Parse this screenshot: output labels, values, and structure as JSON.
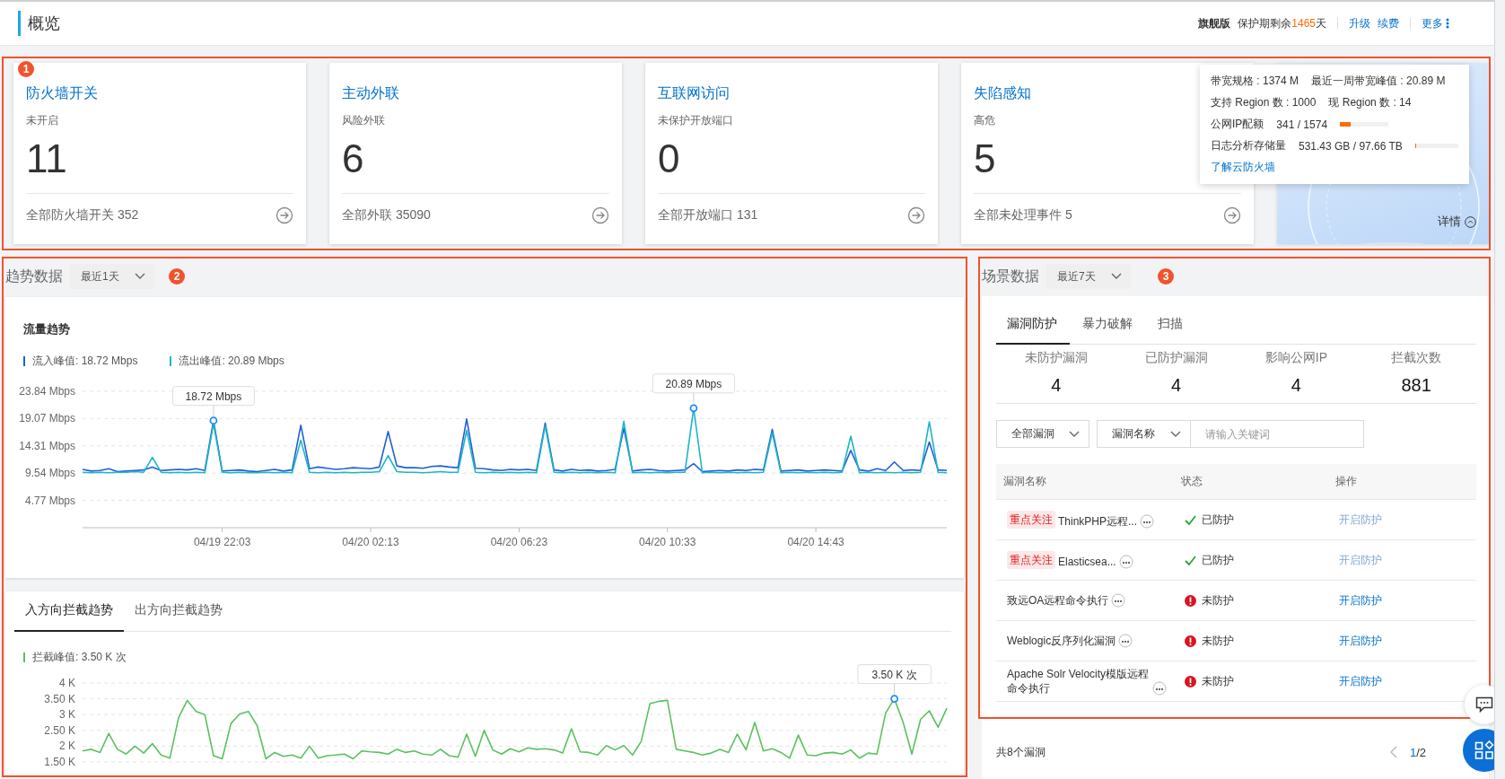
{
  "header": {
    "title": "概览",
    "edition": "旗舰版",
    "remaining_prefix": "保护期剩余",
    "remaining_days": "1465",
    "remaining_suffix": "天",
    "links": [
      "升级",
      "续费"
    ],
    "more": "更多"
  },
  "summary": {
    "badge": "1",
    "cards": [
      {
        "title": "防火墙开关",
        "subtitle": "未开启",
        "value": "11",
        "footer": "全部防火墙开关 352"
      },
      {
        "title": "主动外联",
        "subtitle": "风险外联",
        "value": "6",
        "footer": "全部外联 35090"
      },
      {
        "title": "互联网访问",
        "subtitle": "未保护开放端口",
        "value": "0",
        "footer": "全部开放端口 131"
      },
      {
        "title": "失陷感知",
        "subtitle": "高危",
        "value": "5",
        "footer": "全部未处理事件 5"
      }
    ],
    "quota": {
      "rows": [
        {
          "kind": "pair",
          "items": [
            "带宽规格 : 1374 M",
            "最近一周带宽峰值 : 20.89 M"
          ]
        },
        {
          "kind": "pair",
          "items": [
            "支持 Region 数 : 1000",
            "现 Region 数 : 14"
          ]
        },
        {
          "kind": "meter",
          "label": "公网IP配额",
          "value": "341 / 1574",
          "level": 0.217
        },
        {
          "kind": "meter",
          "label": "日志分析存储量",
          "value": "531.43 GB / 97.66 TB",
          "level": 0.005
        }
      ],
      "link": "了解云防火墙"
    },
    "detail_link": "详情"
  },
  "trend": {
    "badge": "2",
    "title": "趋势数据",
    "range": "最近1天",
    "traffic": {
      "title": "流量趋势",
      "legend": [
        {
          "label": "流入峰值: 18.72 Mbps",
          "color": "#1f5fd6"
        },
        {
          "label": "流出峰值: 20.89 Mbps",
          "color": "#1fb5c9"
        }
      ],
      "chart_data": {
        "type": "line",
        "grid": true,
        "ylim": [
          0,
          23.84
        ],
        "yticks": [
          {
            "value": 4.77,
            "label": "4.77 Mbps"
          },
          {
            "value": 9.54,
            "label": "9.54 Mbps"
          },
          {
            "value": 14.31,
            "label": "14.31 Mbps"
          },
          {
            "value": 19.07,
            "label": "19.07 Mbps"
          },
          {
            "value": 23.84,
            "label": "23.84 Mbps"
          }
        ],
        "categories": [
          null,
          null,
          null,
          null,
          null,
          null,
          null,
          null,
          null,
          null,
          null,
          null,
          null,
          null,
          null,
          null,
          "04/19 22:03",
          null,
          null,
          null,
          null,
          null,
          null,
          null,
          null,
          null,
          null,
          null,
          null,
          null,
          null,
          null,
          null,
          "04/20 02:13",
          null,
          null,
          null,
          null,
          null,
          null,
          null,
          null,
          null,
          null,
          null,
          null,
          null,
          null,
          null,
          null,
          "04/20 06:23",
          null,
          null,
          null,
          null,
          null,
          null,
          null,
          null,
          null,
          null,
          null,
          null,
          null,
          null,
          null,
          null,
          "04/20 10:33",
          null,
          null,
          null,
          null,
          null,
          null,
          null,
          null,
          null,
          null,
          null,
          null,
          null,
          null,
          null,
          null,
          "04/20 14:43",
          null,
          null,
          null,
          null,
          null,
          null,
          null,
          null,
          null,
          null,
          null,
          null,
          null,
          null,
          null
        ],
        "series": [
          {
            "color": "#1f5fd6",
            "values": [
              10.2,
              9.9,
              10.0,
              10.3,
              9.8,
              9.9,
              10.0,
              10.1,
              10.6,
              10.0,
              10.1,
              10.2,
              10.1,
              10.3,
              10.0,
              18.72,
              9.9,
              10.0,
              10.1,
              9.9,
              9.8,
              10.0,
              10.2,
              9.9,
              10.1,
              17.9,
              10.3,
              10.6,
              10.4,
              10.2,
              10.3,
              10.5,
              10.4,
              10.3,
              10.6,
              16.8,
              10.8,
              10.5,
              10.5,
              10.4,
              10.7,
              10.8,
              10.6,
              10.5,
              19.0,
              10.4,
              10.3,
              10.1,
              10.0,
              10.2,
              10.1,
              10.2,
              10.0,
              18.3,
              10.1,
              9.9,
              10.2,
              10.0,
              10.1,
              9.9,
              10.0,
              10.2,
              17.4,
              9.9,
              10.1,
              10.2,
              10.0,
              9.9,
              10.0,
              10.1,
              11.2,
              9.8,
              9.9,
              10.0,
              9.9,
              10.1,
              10.0,
              10.2,
              10.1,
              17.2,
              9.9,
              10.0,
              10.1,
              9.9,
              10.0,
              10.1,
              10.0,
              9.9,
              13.5,
              10.1,
              9.9,
              10.3,
              10.0,
              11.5,
              10.0,
              10.1,
              10.0,
              15.0,
              10.1,
              10.0
            ]
          },
          {
            "color": "#1fb5c9",
            "values": [
              9.7,
              9.6,
              9.7,
              9.6,
              9.7,
              9.7,
              9.8,
              9.7,
              12.3,
              9.7,
              9.6,
              9.7,
              9.6,
              9.7,
              9.6,
              18.2,
              9.7,
              9.6,
              9.7,
              9.6,
              9.6,
              9.7,
              9.6,
              9.7,
              9.6,
              15.3,
              9.7,
              9.6,
              9.7,
              9.6,
              9.7,
              9.6,
              9.7,
              9.7,
              9.8,
              12.6,
              9.8,
              9.7,
              9.7,
              9.6,
              9.7,
              9.8,
              9.7,
              9.7,
              17.0,
              9.7,
              9.6,
              9.7,
              9.6,
              9.7,
              9.6,
              9.7,
              9.6,
              17.8,
              9.7,
              9.6,
              9.7,
              9.6,
              9.7,
              9.6,
              9.7,
              9.6,
              18.6,
              9.6,
              9.7,
              9.6,
              9.7,
              9.6,
              9.7,
              9.7,
              20.89,
              9.6,
              9.7,
              9.6,
              9.7,
              9.6,
              9.7,
              9.6,
              9.7,
              16.6,
              9.6,
              9.7,
              9.6,
              9.7,
              9.6,
              9.7,
              9.6,
              9.7,
              16.0,
              9.6,
              9.7,
              9.6,
              9.7,
              9.6,
              9.7,
              9.6,
              9.7,
              18.5,
              9.7,
              9.6
            ]
          }
        ],
        "annotations": [
          {
            "y": 18.72,
            "text": "18.72 Mbps"
          },
          {
            "y": 20.89,
            "text": "20.89 Mbps"
          }
        ]
      }
    },
    "block": {
      "tabs": [
        {
          "label": "入方向拦截趋势",
          "selected": true
        },
        {
          "label": "出方向拦截趋势",
          "selected": false
        }
      ],
      "legend": [
        {
          "label": "拦截峰值: 3.50 K 次",
          "color": "#5bc15f"
        }
      ],
      "chart_data": {
        "type": "line",
        "grid": true,
        "ylim": [
          1.5,
          4
        ],
        "yticks": [
          {
            "value": 1.5,
            "label": "1.50 K"
          },
          {
            "value": 2,
            "label": "2 K"
          },
          {
            "value": 2.5,
            "label": "2.50 K"
          },
          {
            "value": 3,
            "label": "3 K"
          },
          {
            "value": 3.5,
            "label": "3.50 K"
          },
          {
            "value": 4,
            "label": "4 K"
          }
        ],
        "series": [
          {
            "color": "#5bc15f",
            "values": [
              1.85,
              1.9,
              1.8,
              2.4,
              1.9,
              1.75,
              2.0,
              1.78,
              2.08,
              1.72,
              1.62,
              2.9,
              3.45,
              3.1,
              3.0,
              1.7,
              1.6,
              2.72,
              3.02,
              3.1,
              2.65,
              1.6,
              1.8,
              1.68,
              1.72,
              1.62,
              2.0,
              1.62,
              1.7,
              1.72,
              1.75,
              1.6,
              1.85,
              1.82,
              1.8,
              1.75,
              1.9,
              1.8,
              1.85,
              1.75,
              1.72,
              1.9,
              1.7,
              1.65,
              2.38,
              1.68,
              2.5,
              1.88,
              1.75,
              1.92,
              1.82,
              1.95,
              1.9,
              1.92,
              1.88,
              1.78,
              2.55,
              1.82,
              1.8,
              1.72,
              2.02,
              1.88,
              2.02,
              1.72,
              2.15,
              3.35,
              3.42,
              3.45,
              1.9,
              1.85,
              1.8,
              1.72,
              1.78,
              1.9,
              1.8,
              2.38,
              1.88,
              2.75,
              1.85,
              1.92,
              1.8,
              1.62,
              2.35,
              1.72,
              1.7,
              1.78,
              1.8,
              1.75,
              1.88,
              1.62,
              1.78,
              1.75,
              3.05,
              3.5,
              2.75,
              1.75,
              2.85,
              3.12,
              2.6,
              3.2
            ]
          }
        ],
        "annotations": [
          {
            "y": 3.5,
            "text": "3.50 K 次"
          }
        ]
      }
    }
  },
  "scene": {
    "badge": "3",
    "title": "场景数据",
    "range": "最近7天",
    "tabs": [
      {
        "label": "漏洞防护",
        "selected": true
      },
      {
        "label": "暴力破解",
        "selected": false
      },
      {
        "label": "扫描",
        "selected": false
      }
    ],
    "stats": [
      {
        "label": "未防护漏洞",
        "value": "4"
      },
      {
        "label": "已防护漏洞",
        "value": "4"
      },
      {
        "label": "影响公网IP",
        "value": "4"
      },
      {
        "label": "拦截次数",
        "value": "881"
      }
    ],
    "filters": {
      "type": "全部漏洞",
      "field": "漏洞名称",
      "search_placeholder": "请输入关键词"
    },
    "table": {
      "columns": [
        "漏洞名称",
        "状态",
        "操作"
      ],
      "rows": [
        {
          "tag": "重点关注",
          "name": "ThinkPHP远程...",
          "protected": true,
          "status": "已防护",
          "action": "开启防护",
          "action_disabled": true
        },
        {
          "tag": "重点关注",
          "name": "Elasticsea...",
          "protected": true,
          "status": "已防护",
          "action": "开启防护",
          "action_disabled": true
        },
        {
          "name": "致远OA远程命令执行",
          "protected": false,
          "status": "未防护",
          "action": "开启防护",
          "action_disabled": false
        },
        {
          "name": "Weblogic反序列化漏洞",
          "protected": false,
          "status": "未防护",
          "action": "开启防护",
          "action_disabled": false
        },
        {
          "name": "Apache Solr Velocity模版远程命令执行",
          "protected": false,
          "status": "未防护",
          "action": "开启防护",
          "action_disabled": false
        }
      ]
    },
    "footer": {
      "total": "共8个漏洞",
      "page_current": "1",
      "page_rest": "/2"
    }
  }
}
